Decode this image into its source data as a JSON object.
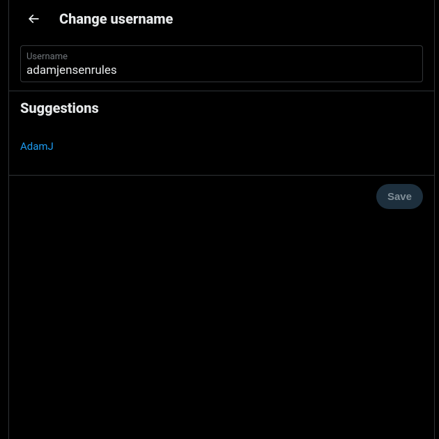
{
  "header": {
    "title": "Change username"
  },
  "username": {
    "label": "Username",
    "value": "adamjensenrules"
  },
  "suggestions": {
    "title": "Suggestions",
    "items": [
      {
        "label": "AdamJ"
      }
    ]
  },
  "actions": {
    "save_label": "Save"
  }
}
